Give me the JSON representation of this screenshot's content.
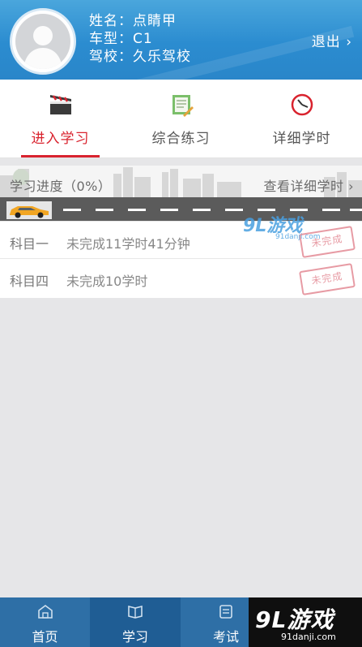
{
  "header": {
    "name_row": "姓名：点睛甲",
    "car_row": "车型：C1",
    "school_row": "驾校：久乐驾校",
    "logout": "退出 ›"
  },
  "tabs": [
    {
      "label": "进入学习",
      "icon": "clapperboard-icon",
      "active": true
    },
    {
      "label": "综合练习",
      "icon": "notebook-pencil-icon",
      "active": false
    },
    {
      "label": "详细学时",
      "icon": "clock-icon",
      "active": false
    }
  ],
  "progress": {
    "title": "学习进度（0%）",
    "link": "查看详细学时 ›",
    "value": 0
  },
  "subjects": [
    {
      "name": "科目一",
      "status": "未完成11学时41分钟",
      "stamp": "未完成"
    },
    {
      "name": "科目四",
      "status": "未完成10学时",
      "stamp": "未完成"
    }
  ],
  "watermark": {
    "logo": "9L游戏",
    "url": "91danji.com"
  },
  "bottom_nav": [
    {
      "label": "首页",
      "icon": "home-icon",
      "active": false
    },
    {
      "label": "学习",
      "icon": "book-icon",
      "active": true
    },
    {
      "label": "考试",
      "icon": "exam-icon",
      "active": false
    }
  ],
  "brand": {
    "logo": "9L游戏",
    "url": "91danji.com"
  },
  "colors": {
    "header": "#2b8cd0",
    "accent": "#d9232e",
    "nav": "#2e6fa6"
  }
}
